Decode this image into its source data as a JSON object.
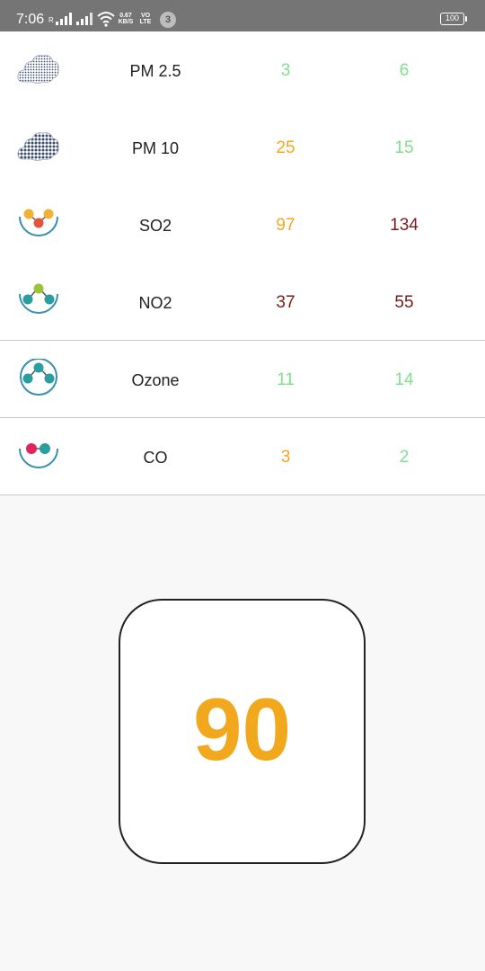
{
  "status_bar": {
    "time": "7:06",
    "roaming": "R",
    "net_speed": "0.67",
    "net_speed_unit": "KB/S",
    "volte_line1": "VO",
    "volte_line2": "LTE",
    "notification_count": "3",
    "battery": "100"
  },
  "colors": {
    "good": "#7ee08c",
    "moderate": "#f2a81d",
    "poor": "#7a1a1a",
    "aqi": "#f2a81d"
  },
  "pollutants": [
    {
      "icon": "pm25-cloud-icon",
      "name": "PM 2.5",
      "value1": "3",
      "value1_level": "good",
      "value2": "6",
      "value2_level": "good"
    },
    {
      "icon": "pm10-cloud-icon",
      "name": "PM 10",
      "value1": "25",
      "value1_level": "moderate",
      "value2": "15",
      "value2_level": "good"
    },
    {
      "icon": "so2-molecule-icon",
      "name": "SO2",
      "value1": "97",
      "value1_level": "moderate",
      "value2": "134",
      "value2_level": "poor"
    },
    {
      "icon": "no2-molecule-icon",
      "name": "NO2",
      "value1": "37",
      "value1_level": "poor",
      "value2": "55",
      "value2_level": "poor"
    },
    {
      "icon": "ozone-molecule-icon",
      "name": "Ozone",
      "value1": "11",
      "value1_level": "good",
      "value2": "14",
      "value2_level": "good"
    },
    {
      "icon": "co-molecule-icon",
      "name": "CO",
      "value1": "3",
      "value1_level": "moderate",
      "value2": "2",
      "value2_level": "good"
    }
  ],
  "aqi": {
    "value": "90"
  }
}
